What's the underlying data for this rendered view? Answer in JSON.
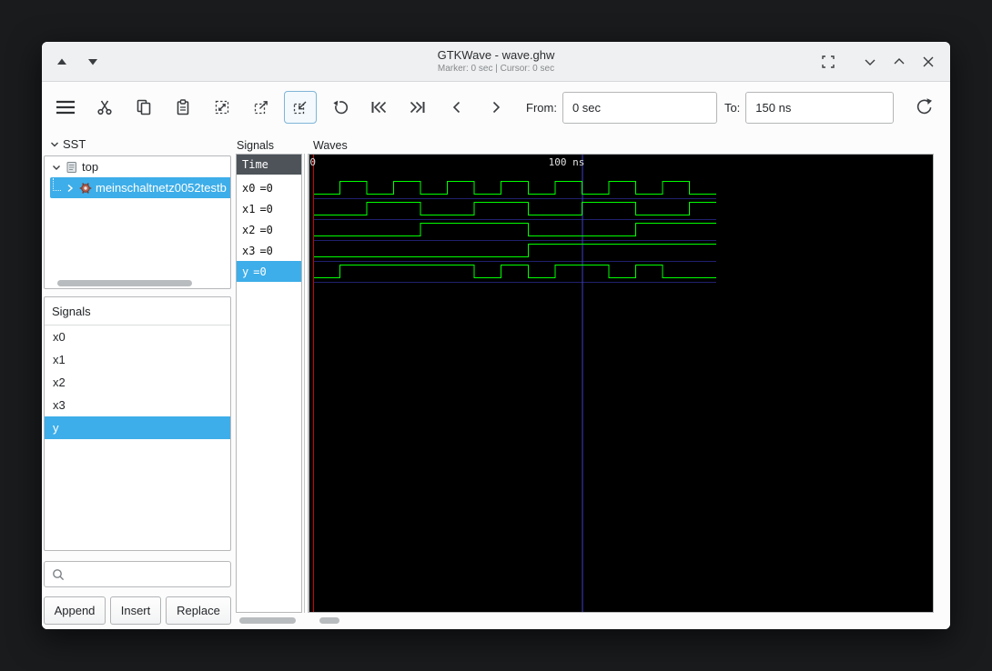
{
  "window": {
    "title": "GTKWave - wave.ghw",
    "status": "Marker: 0 sec | Cursor: 0 sec"
  },
  "toolbar": {
    "from_label": "From:",
    "from_value": "0 sec",
    "to_label": "To:",
    "to_value": "150 ns"
  },
  "sst": {
    "header": "SST",
    "items": [
      {
        "label": "top",
        "type": "scope",
        "expanded": true,
        "selected": false
      },
      {
        "label": "meinschaltnetz0052testb",
        "type": "entity",
        "expanded": false,
        "selected": true
      }
    ]
  },
  "facs": {
    "header": "Signals",
    "items": [
      {
        "label": "x0",
        "selected": false
      },
      {
        "label": "x1",
        "selected": false
      },
      {
        "label": "x2",
        "selected": false
      },
      {
        "label": "x3",
        "selected": false
      },
      {
        "label": "y",
        "selected": true
      }
    ],
    "buttons": {
      "append": "Append",
      "insert": "Insert",
      "replace": "Replace"
    }
  },
  "names_panel": {
    "title": "Signals",
    "time_header": "Time",
    "rows": [
      {
        "name": "x0",
        "value": "=0",
        "selected": false
      },
      {
        "name": "x1",
        "value": "=0",
        "selected": false
      },
      {
        "name": "x2",
        "value": "=0",
        "selected": false
      },
      {
        "name": "x3",
        "value": "=0",
        "selected": false
      },
      {
        "name": "y",
        "value": "=0",
        "selected": true
      }
    ]
  },
  "waves": {
    "title": "Waves",
    "time_unit": "ns",
    "time_start_ns": 0,
    "time_end_ns": 150,
    "marker_ns": 0,
    "grid_ns": 100,
    "timeline": [
      {
        "time_ns": 0,
        "label": "0"
      },
      {
        "time_ns": 100,
        "label": "100 ns"
      }
    ],
    "colors": {
      "background": "#000000",
      "trace": "#00ff00",
      "marker": "#d40000",
      "grid": "#4040c8",
      "row_separator": "#20206e",
      "timeline_text": "#e0e0e0",
      "selection": "#3daee9"
    },
    "signals": [
      {
        "name": "x0",
        "transitions": [
          [
            0,
            0
          ],
          [
            10,
            1
          ],
          [
            20,
            0
          ],
          [
            30,
            1
          ],
          [
            40,
            0
          ],
          [
            50,
            1
          ],
          [
            60,
            0
          ],
          [
            70,
            1
          ],
          [
            80,
            0
          ],
          [
            90,
            1
          ],
          [
            100,
            0
          ],
          [
            110,
            1
          ],
          [
            120,
            0
          ],
          [
            130,
            1
          ],
          [
            140,
            0
          ]
        ]
      },
      {
        "name": "x1",
        "transitions": [
          [
            0,
            0
          ],
          [
            20,
            1
          ],
          [
            40,
            0
          ],
          [
            60,
            1
          ],
          [
            80,
            0
          ],
          [
            100,
            1
          ],
          [
            120,
            0
          ],
          [
            140,
            1
          ]
        ]
      },
      {
        "name": "x2",
        "transitions": [
          [
            0,
            0
          ],
          [
            40,
            1
          ],
          [
            80,
            0
          ],
          [
            120,
            1
          ]
        ]
      },
      {
        "name": "x3",
        "transitions": [
          [
            0,
            0
          ],
          [
            80,
            1
          ]
        ]
      },
      {
        "name": "y",
        "transitions": [
          [
            0,
            0
          ],
          [
            10,
            1
          ],
          [
            60,
            0
          ],
          [
            70,
            1
          ],
          [
            80,
            0
          ],
          [
            90,
            1
          ],
          [
            110,
            0
          ],
          [
            120,
            1
          ],
          [
            130,
            0
          ]
        ]
      }
    ]
  }
}
